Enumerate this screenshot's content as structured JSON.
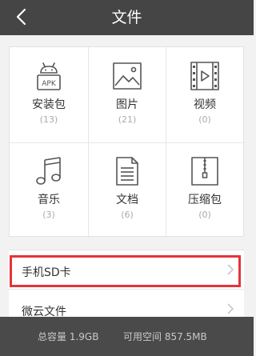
{
  "header": {
    "title": "文件",
    "back_icon": "back-chevron-icon"
  },
  "categories": [
    {
      "label": "安装包",
      "count": "(13)",
      "icon": "android-apk-icon"
    },
    {
      "label": "图片",
      "count": "(21)",
      "icon": "image-icon"
    },
    {
      "label": "视频",
      "count": "(0)",
      "icon": "video-film-icon"
    },
    {
      "label": "音乐",
      "count": "(3)",
      "icon": "music-note-icon"
    },
    {
      "label": "文档",
      "count": "(6)",
      "icon": "document-icon"
    },
    {
      "label": "压缩包",
      "count": "(0)",
      "icon": "zip-archive-icon"
    }
  ],
  "apk_badge": "APK",
  "storage_list": [
    {
      "label": "手机SD卡",
      "highlighted": true
    },
    {
      "label": "微云文件",
      "highlighted": false
    }
  ],
  "footer": {
    "total": "总容量 1.9GB",
    "free": "可用空间 857.5MB"
  },
  "colors": {
    "header_bg": "#454545",
    "footer_bg": "#4a4a4a",
    "highlight": "#e5343a",
    "icon_stroke": "#555555"
  }
}
